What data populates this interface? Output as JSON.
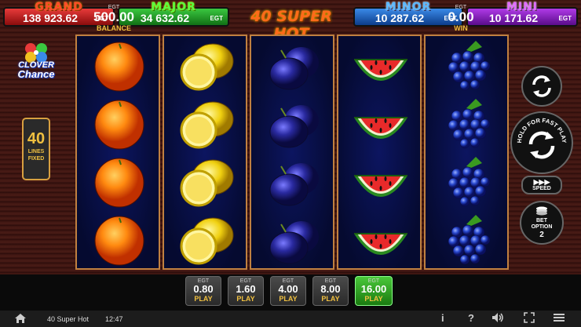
{
  "jackpots": [
    {
      "name": "GRAND",
      "value": "138 923.62",
      "currency": "EGT"
    },
    {
      "name": "MAJOR",
      "value": "34 632.62",
      "currency": "EGT"
    },
    {
      "name": "MINOR",
      "value": "10 287.62",
      "currency": "EGT"
    },
    {
      "name": "MINI",
      "value": "10 171.62",
      "currency": "EGT"
    }
  ],
  "game_title": "40 SUPER HOT",
  "logo": {
    "line1": "CLOVER",
    "line2": "Chance"
  },
  "lines": {
    "count": "40",
    "label1": "LINES",
    "label2": "FIXED"
  },
  "reels": [
    {
      "symbol": "orange",
      "rows": [
        "orange-icon",
        "orange-icon",
        "orange-icon",
        "orange-icon"
      ]
    },
    {
      "symbol": "lemon",
      "rows": [
        "lemon-icon",
        "lemon-icon",
        "lemon-icon",
        "lemon-icon"
      ]
    },
    {
      "symbol": "plum",
      "rows": [
        "plum-icon",
        "plum-icon",
        "plum-icon",
        "plum-icon"
      ]
    },
    {
      "symbol": "watermelon",
      "rows": [
        "watermelon-icon",
        "watermelon-icon",
        "watermelon-icon",
        "watermelon-icon"
      ]
    },
    {
      "symbol": "grapes",
      "rows": [
        "grapes-icon",
        "grapes-icon",
        "grapes-icon",
        "grapes-icon"
      ]
    }
  ],
  "controls": {
    "autoplay_icon": "autoplay-icon",
    "fast_play_label": "HOLD FOR FAST PLAY",
    "speed_label": "SPEED",
    "bet_option_label1": "BET",
    "bet_option_label2": "OPTION",
    "bet_option_value": "2"
  },
  "balance": {
    "currency": "EGT",
    "amount": "500.00",
    "label": "BALANCE"
  },
  "win": {
    "currency": "EGT",
    "amount": "0.00",
    "label": "WIN"
  },
  "bets": [
    {
      "currency": "EGT",
      "amount": "0.80",
      "label": "PLAY"
    },
    {
      "currency": "EGT",
      "amount": "1.60",
      "label": "PLAY"
    },
    {
      "currency": "EGT",
      "amount": "4.00",
      "label": "PLAY"
    },
    {
      "currency": "EGT",
      "amount": "8.00",
      "label": "PLAY"
    },
    {
      "currency": "EGT",
      "amount": "16.00",
      "label": "PLAY"
    }
  ],
  "status_bar": {
    "title": "40 Super Hot",
    "time": "12:47"
  }
}
